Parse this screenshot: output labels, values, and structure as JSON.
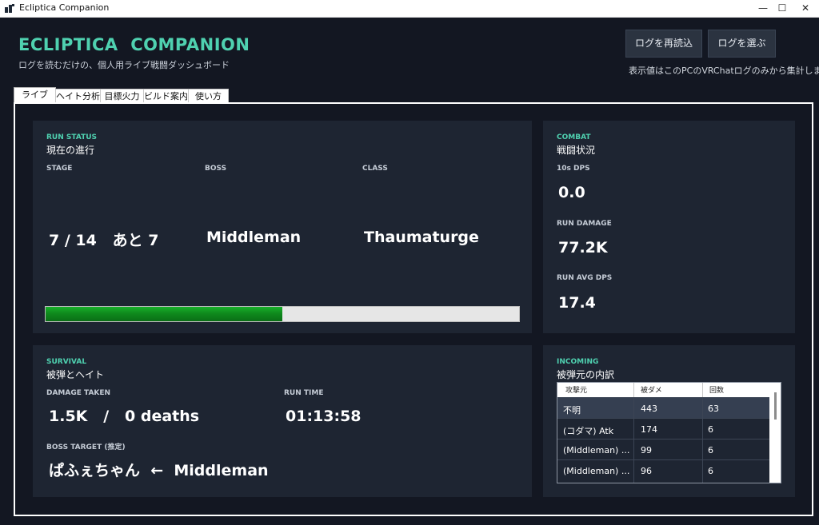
{
  "window": {
    "title": "Ecliptica Companion",
    "min": "—",
    "max": "☐",
    "close": "✕"
  },
  "header": {
    "title": "ECLIPTICA  COMPANION",
    "subtitle": "ログを読むだけの、個人用ライブ戦闘ダッシュボード",
    "reload_label": "ログを再読込",
    "choose_label": "ログを選ぶ",
    "note": "表示値はこのPCのVRChatログのみから集計します"
  },
  "tabs": [
    "ライブ",
    "ヘイト分析",
    "目標火力",
    "ビルド案内",
    "使い方"
  ],
  "run_status": {
    "eyebrow": "RUN STATUS",
    "title": "現在の進行",
    "stage_label": "STAGE",
    "boss_label": "BOSS",
    "class_label": "CLASS",
    "stage_value": "7 / 14   あと 7",
    "boss_value": "Middleman",
    "class_value": "Thaumaturge",
    "progress": 0.5
  },
  "combat": {
    "eyebrow": "COMBAT",
    "title": "戦闘状況",
    "dps10_label": "10s DPS",
    "dps10_value": "0.0",
    "run_damage_label": "RUN DAMAGE",
    "run_damage_value": "77.2K",
    "avg_dps_label": "RUN AVG DPS",
    "avg_dps_value": "17.4"
  },
  "survival": {
    "eyebrow": "SURVIVAL",
    "title": "被弾とヘイト",
    "damage_label": "DAMAGE TAKEN",
    "damage_value": "1.5K   /   0 deaths",
    "time_label": "RUN TIME",
    "time_value": "01:13:58",
    "target_label": "BOSS TARGET (推定)",
    "target_value": "ぱふぇちゃん  ←  Middleman"
  },
  "incoming": {
    "eyebrow": "INCOMING",
    "title": "被弾元の内訳",
    "columns": [
      "攻撃元",
      "被ダメ",
      "回数"
    ],
    "rows": [
      [
        "不明",
        "443",
        "63"
      ],
      [
        "(コダマ) Atk",
        "174",
        "6"
      ],
      [
        "(Middleman) ...",
        "99",
        "6"
      ],
      [
        "(Middleman) ...",
        "96",
        "6"
      ]
    ]
  }
}
